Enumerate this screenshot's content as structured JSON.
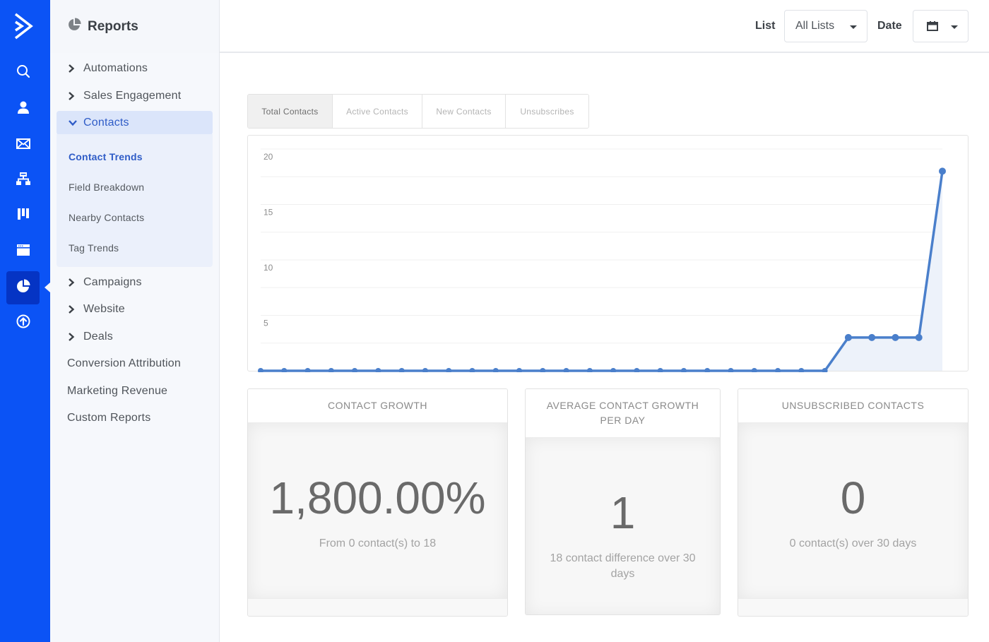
{
  "rail": {
    "items": [
      {
        "icon": "search-icon",
        "label": "Search"
      },
      {
        "icon": "contacts-icon",
        "label": "Contacts"
      },
      {
        "icon": "campaigns-icon",
        "label": "Campaigns"
      },
      {
        "icon": "automations-icon",
        "label": "Automations"
      },
      {
        "icon": "deals-icon",
        "label": "Deals"
      },
      {
        "icon": "website-icon",
        "label": "Website"
      },
      {
        "icon": "reports-icon",
        "label": "Reports",
        "active": true
      },
      {
        "icon": "upgrade-icon",
        "label": "Upgrade"
      }
    ]
  },
  "sidebar": {
    "title": "Reports",
    "items": [
      {
        "label": "Automations",
        "expandable": true
      },
      {
        "label": "Sales Engagement",
        "expandable": true
      },
      {
        "label": "Contacts",
        "expandable": true,
        "expanded": true
      },
      {
        "label": "Campaigns",
        "expandable": true
      },
      {
        "label": "Website",
        "expandable": true
      },
      {
        "label": "Deals",
        "expandable": true
      },
      {
        "label": "Conversion Attribution"
      },
      {
        "label": "Marketing Revenue"
      },
      {
        "label": "Custom Reports"
      }
    ],
    "contacts_subitems": [
      {
        "label": "Contact Trends",
        "active": true
      },
      {
        "label": "Field Breakdown"
      },
      {
        "label": "Nearby Contacts"
      },
      {
        "label": "Tag Trends"
      }
    ]
  },
  "topbar": {
    "list_label": "List",
    "list_value": "All Lists",
    "date_label": "Date",
    "date_icon": "calendar-icon"
  },
  "tabs": [
    {
      "label": "Total Contacts",
      "active": true
    },
    {
      "label": "Active Contacts"
    },
    {
      "label": "New Contacts"
    },
    {
      "label": "Unsubscribes"
    }
  ],
  "chart_data": {
    "type": "area",
    "title": "",
    "xlabel": "",
    "ylabel": "",
    "ylim": [
      0,
      20
    ],
    "yticks": [
      5,
      10,
      15,
      20
    ],
    "grid": true,
    "legend": "none",
    "series": [
      {
        "name": "Total Contacts",
        "color": "#4a7fcb",
        "fill": "#edf2fa",
        "values": [
          0,
          0,
          0,
          0,
          0,
          0,
          0,
          0,
          0,
          0,
          0,
          0,
          0,
          0,
          0,
          0,
          0,
          0,
          0,
          0,
          0,
          0,
          0,
          0,
          0,
          3,
          3,
          3,
          3,
          18
        ]
      }
    ]
  },
  "cards": [
    {
      "title": "CONTACT GROWTH",
      "value": "1,800.00%",
      "subtitle": "From 0 contact(s) to 18"
    },
    {
      "title": "AVERAGE CONTACT GROWTH PER DAY",
      "value": "1",
      "subtitle": "18 contact difference over 30 days"
    },
    {
      "title": "UNSUBSCRIBED CONTACTS",
      "value": "0",
      "subtitle": "0 contact(s) over 30 days"
    }
  ]
}
